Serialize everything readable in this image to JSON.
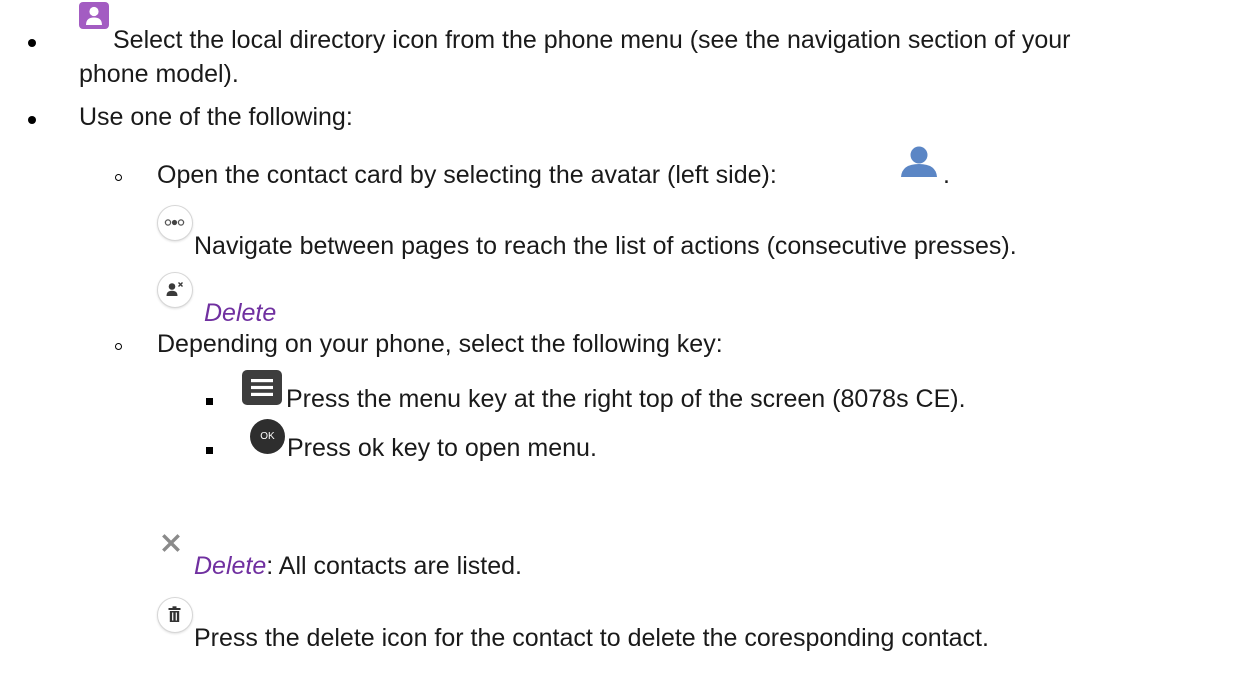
{
  "colors": {
    "accent_purple": "#7030a0",
    "directory_icon": "#a35cc2",
    "avatar_blue": "#5b86c5",
    "menu_key": "#3d3d3d",
    "ok_key": "#2e2e2e"
  },
  "steps": {
    "select_directory": {
      "icon": "local-directory-icon",
      "line1": "Select the local directory icon from the phone menu (see the navigation section of your",
      "line2": "phone model)."
    },
    "use_one_of": "Use one of the following:",
    "open_contact": {
      "text": "Open the contact card by selecting the avatar (left side):",
      "end": ".",
      "icon": "avatar-icon",
      "navigate": {
        "icon": "more-pages-icon",
        "text": "Navigate between pages to reach the list of actions (consecutive presses)."
      },
      "delete": {
        "icon": "delete-contact-icon",
        "text": "Delete"
      }
    },
    "depending": {
      "text": "Depending on your phone, select the following key:",
      "menu_key": {
        "icon": "menu-key-icon",
        "text": "Press the menu key at the right top of the screen (8078s CE)."
      },
      "ok_key": {
        "icon": "ok-key-icon",
        "icon_text": "OK",
        "text": "Press ok key to open menu."
      }
    },
    "delete_all": {
      "icon": "close-icon",
      "label": "Delete",
      "text": ": All contacts are listed."
    },
    "delete_contact": {
      "icon": "trash-icon",
      "text": "Press the delete icon for the contact to delete the coresponding contact."
    }
  }
}
